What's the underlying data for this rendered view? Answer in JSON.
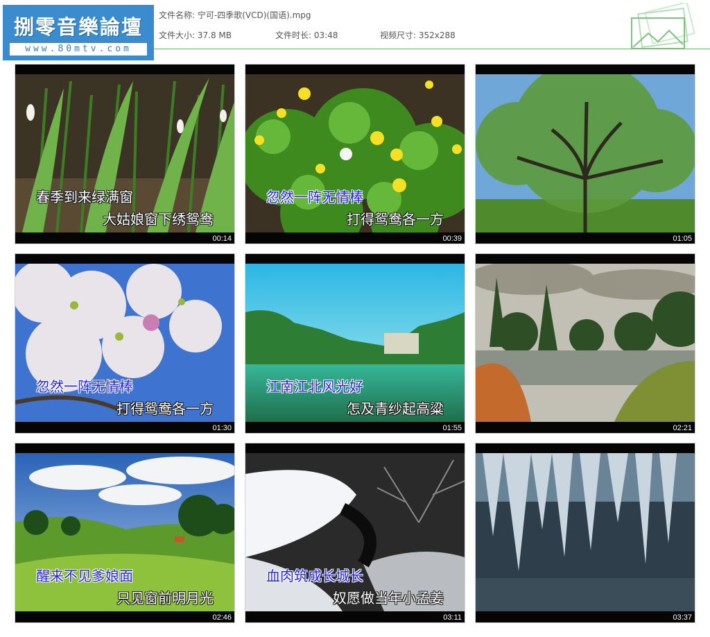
{
  "logo": {
    "title": "捌零音樂論壇",
    "url": "www.80mtv.com"
  },
  "file": {
    "name_label": "文件名称:",
    "name": "宁可-四季歌(VCD)(国语).mpg",
    "size_label": "文件大小:",
    "size": "37.8 MB",
    "duration_label": "文件时长:",
    "duration": "03:48",
    "dims_label": "视频尺寸:",
    "dims": "352x288"
  },
  "colors": {
    "logo_bg": "#3a8ccf",
    "divider": "#76b876",
    "lyric_blue": "#2424e8"
  },
  "thumbnails": [
    {
      "time": "00:14",
      "scene": "snowdrops",
      "line1": "春季到来绿满窗",
      "line2": "大姑娘窗下绣鸳鸯",
      "line1_color": "white",
      "line2_color": "white"
    },
    {
      "time": "00:39",
      "scene": "yellow-flowers",
      "line1": "忽然一阵无情棒",
      "line2": "打得鸳鸯各一方",
      "line1_color": "blue",
      "line2_color": "white"
    },
    {
      "time": "01:05",
      "scene": "oak-tree",
      "line1": "",
      "line2": "",
      "line1_color": "white",
      "line2_color": "white"
    },
    {
      "time": "01:30",
      "scene": "blossoms",
      "line1": "忽然一阵无情棒",
      "line2": "打得鸳鸯各一方",
      "line1_color": "blue",
      "line2_color": "white"
    },
    {
      "time": "01:55",
      "scene": "green-lake",
      "line1": "江南江北风光好",
      "line2": "怎及青纱起高粱",
      "line1_color": "blue",
      "line2_color": "white"
    },
    {
      "time": "02:21",
      "scene": "autumn-pond",
      "line1": "",
      "line2": "",
      "line1_color": "white",
      "line2_color": "white"
    },
    {
      "time": "02:46",
      "scene": "meadow",
      "line1": "醒来不见爹娘面",
      "line2": "只见窗前明月光",
      "line1_color": "blue",
      "line2_color": "white"
    },
    {
      "time": "03:11",
      "scene": "snow-stream",
      "line1": "血肉筑成长城长",
      "line2": "奴愿做当年小孟姜",
      "line1_color": "blue",
      "line2_color": "white"
    },
    {
      "time": "03:37",
      "scene": "icicles",
      "line1": "",
      "line2": "",
      "line1_color": "white",
      "line2_color": "white"
    }
  ]
}
